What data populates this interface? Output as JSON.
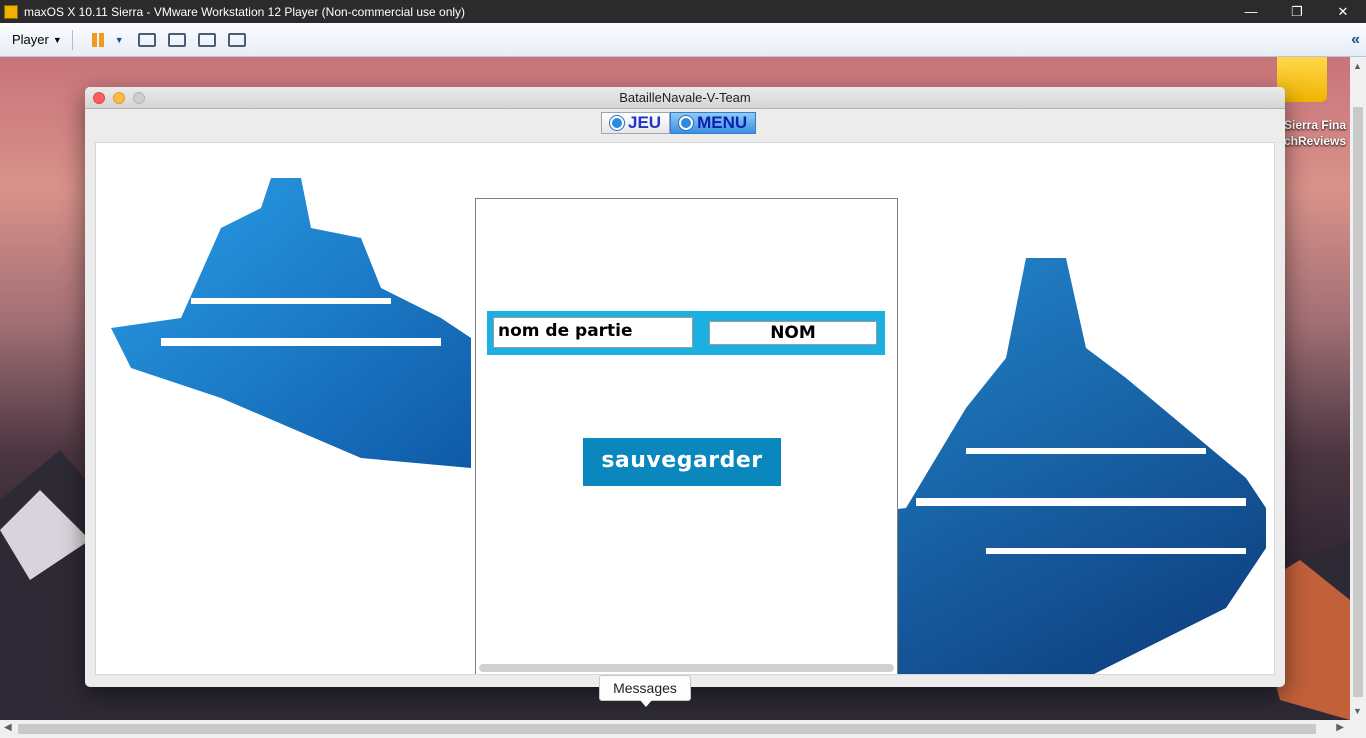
{
  "vmware": {
    "title": "maxOS X 10.11 Sierra - VMware Workstation 12 Player (Non-commercial use only)",
    "player_menu": "Player",
    "icons": [
      "pause-icon",
      "send-ctrl-alt-del-icon",
      "removable-devices-icon",
      "fullscreen-icon",
      "unity-icon",
      "collapse-toolbar-icon"
    ]
  },
  "desktop": {
    "drive_label": "Sierra Fina\nchReviews"
  },
  "app": {
    "title": "BatailleNavale-V-Team",
    "tabs": [
      {
        "label": "JEU",
        "selected": false
      },
      {
        "label": "MENU",
        "selected": true
      }
    ],
    "name_field": {
      "value": "nom de partie"
    },
    "nom_button": "NOM",
    "save_button": "sauvegarder"
  },
  "messages_tooltip": "Messages",
  "colors": {
    "accent_bar": "#1ab0e2",
    "save_button": "#0a87bd",
    "tab_text": "#1f35c9"
  }
}
